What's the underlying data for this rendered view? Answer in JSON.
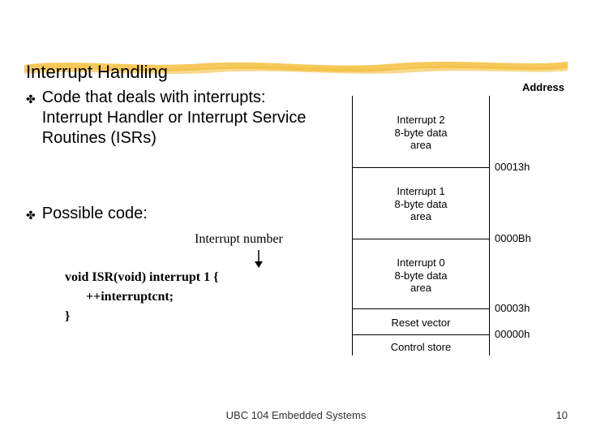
{
  "title": "Interrupt Handling",
  "bullet1": "Code that deals with interrupts: Interrupt Handler or Interrupt Service Routines (ISRs)",
  "bullet2": "Possible code:",
  "annot": "Interrupt number",
  "code": {
    "l1": "void ISR(void) interrupt 1 {",
    "l2": "++interruptcnt;",
    "l3": "}"
  },
  "mem": {
    "address_title": "Address",
    "seg_int2": "Interrupt 2\n8-byte data\narea",
    "seg_int1": "Interrupt 1\n8-byte data\narea",
    "seg_int0": "Interrupt 0\n8-byte data\narea",
    "seg_reset": "Reset vector",
    "seg_control": "Control store",
    "addr_00013": "00013h",
    "addr_0000B": "0000Bh",
    "addr_00003": "00003h",
    "addr_00000": "00000h"
  },
  "footer": "UBC 104 Embedded Systems",
  "pagenum": "10"
}
